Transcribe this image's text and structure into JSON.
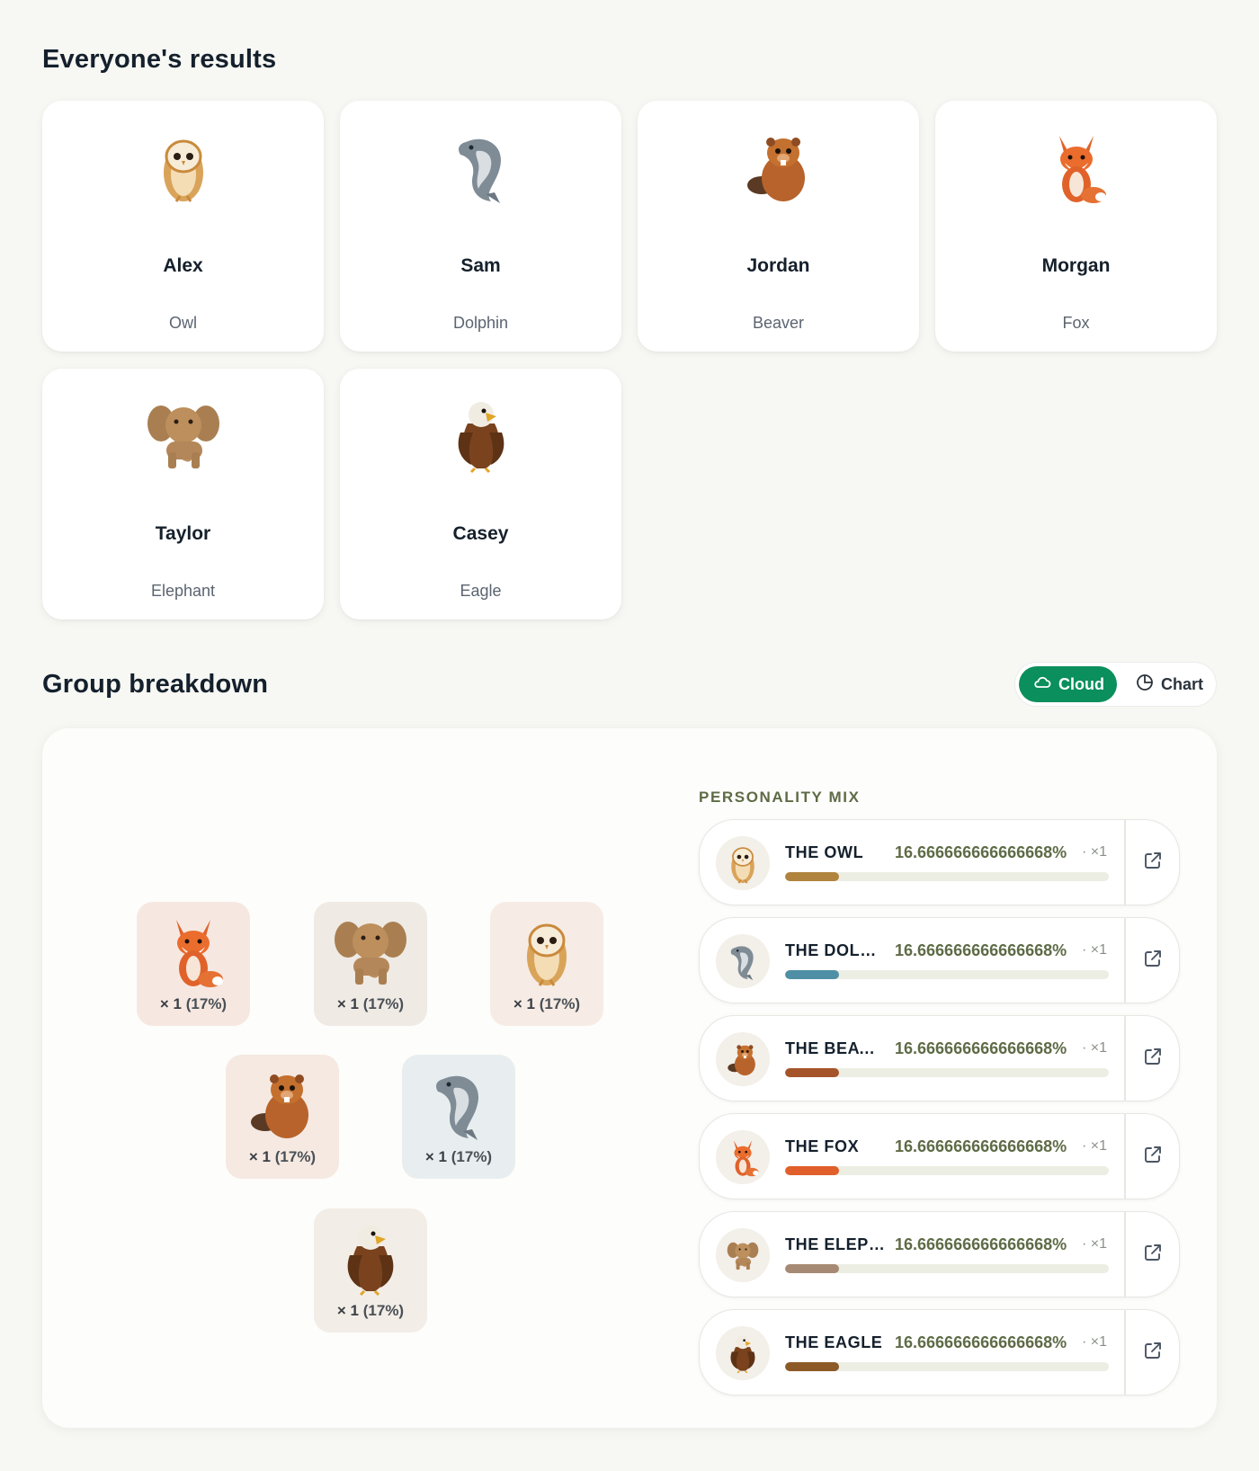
{
  "results": {
    "title": "Everyone's results",
    "people": [
      {
        "name": "Alex",
        "animal": "Owl",
        "icon": "owl-icon"
      },
      {
        "name": "Sam",
        "animal": "Dolphin",
        "icon": "dolphin-icon"
      },
      {
        "name": "Jordan",
        "animal": "Beaver",
        "icon": "beaver-icon"
      },
      {
        "name": "Morgan",
        "animal": "Fox",
        "icon": "fox-icon"
      },
      {
        "name": "Taylor",
        "animal": "Elephant",
        "icon": "elephant-icon"
      },
      {
        "name": "Casey",
        "animal": "Eagle",
        "icon": "eagle-icon"
      }
    ]
  },
  "breakdown": {
    "title": "Group breakdown",
    "toggle": {
      "cloud_label": "Cloud",
      "chart_label": "Chart",
      "active": "Cloud"
    },
    "cloud_tiles": [
      {
        "animal": "fox",
        "mult": "×",
        "count": "1",
        "pct": "(17%)",
        "bg": "#f6e8e1"
      },
      {
        "animal": "elephant",
        "mult": "×",
        "count": "1",
        "pct": "(17%)",
        "bg": "#efeae4"
      },
      {
        "animal": "owl",
        "mult": "×",
        "count": "1",
        "pct": "(17%)",
        "bg": "#f6ece5"
      },
      {
        "animal": "beaver",
        "mult": "×",
        "count": "1",
        "pct": "(17%)",
        "bg": "#f5e9e2"
      },
      {
        "animal": "dolphin",
        "mult": "×",
        "count": "1",
        "pct": "(17%)",
        "bg": "#e8eef0"
      },
      {
        "animal": "eagle",
        "mult": "×",
        "count": "1",
        "pct": "(17%)",
        "bg": "#f2ede6"
      }
    ],
    "mix_label": "PERSONALITY MIX",
    "mix": [
      {
        "name": "THE OWL",
        "percent": "16.666666666666668%",
        "count": "· ×1",
        "fraction": 0.1667,
        "color": "#b0833e",
        "animal": "owl"
      },
      {
        "name": "THE DOLPHIN",
        "percent": "16.666666666666668%",
        "count": "· ×1",
        "fraction": 0.1667,
        "color": "#4f8fa6",
        "animal": "dolphin"
      },
      {
        "name": "THE BEAVER",
        "percent": "16.666666666666668%",
        "count": "· ×1",
        "fraction": 0.1667,
        "color": "#a5542a",
        "animal": "beaver"
      },
      {
        "name": "THE FOX",
        "percent": "16.666666666666668%",
        "count": "· ×1",
        "fraction": 0.1667,
        "color": "#e15f2a",
        "animal": "fox"
      },
      {
        "name": "THE ELEPHANT",
        "percent": "16.666666666666668%",
        "count": "· ×1",
        "fraction": 0.1667,
        "color": "#a68a73",
        "animal": "elephant"
      },
      {
        "name": "THE EAGLE",
        "percent": "16.666666666666668%",
        "count": "· ×1",
        "fraction": 0.1667,
        "color": "#8c5a26",
        "animal": "eagle"
      }
    ]
  }
}
